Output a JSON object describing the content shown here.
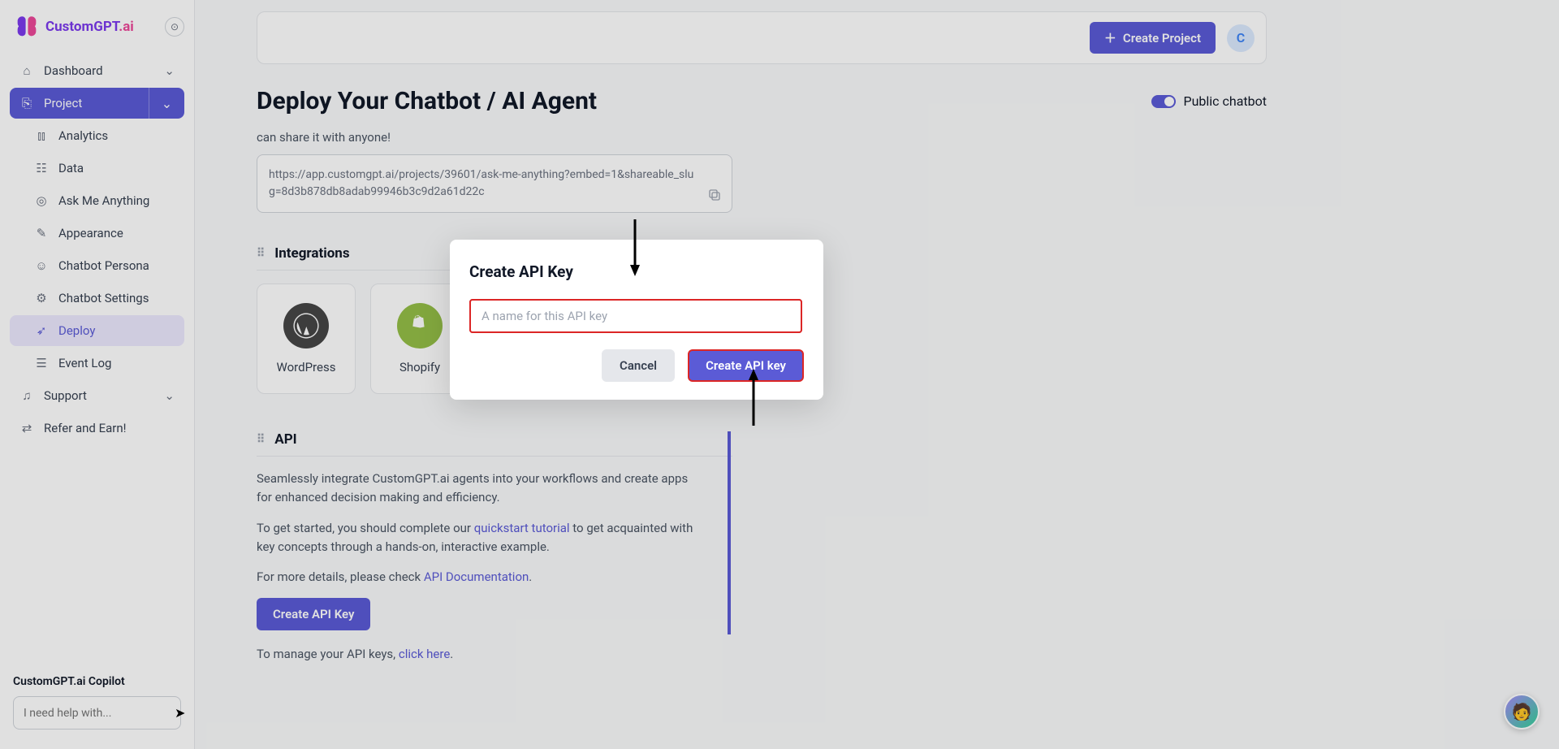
{
  "brand": {
    "name_a": "CustomGPT",
    "name_b": ".ai"
  },
  "sidebar": {
    "items": [
      {
        "label": "Dashboard"
      },
      {
        "label": "Project"
      },
      {
        "label": "Analytics"
      },
      {
        "label": "Data"
      },
      {
        "label": "Ask Me Anything"
      },
      {
        "label": "Appearance"
      },
      {
        "label": "Chatbot Persona"
      },
      {
        "label": "Chatbot Settings"
      },
      {
        "label": "Deploy"
      },
      {
        "label": "Event Log"
      },
      {
        "label": "Support"
      },
      {
        "label": "Refer and Earn!"
      }
    ],
    "copilot_label": "CustomGPT.ai Copilot",
    "copilot_placeholder": "I need help with..."
  },
  "topbar": {
    "create_project": "Create Project",
    "avatar_initial": "C"
  },
  "page": {
    "title": "Deploy Your Chatbot / AI Agent",
    "public_toggle_label": "Public chatbot",
    "share_line": "can share it with anyone!",
    "url": "https://app.customgpt.ai/projects/39601/ask-me-anything?embed=1&shareable_slug=8d3b878db8adab99946b3c9d2a61d22c"
  },
  "integrations": {
    "heading": "Integrations",
    "cards": [
      {
        "label": "WordPress"
      },
      {
        "label": "Shopify"
      }
    ]
  },
  "api": {
    "heading": "API",
    "p1a": "Seamlessly integrate CustomGPT.ai agents into your workflows and create apps for enhanced decision making and efficiency.",
    "p2a": "To get started, you should complete our ",
    "p2link": "quickstart tutorial",
    "p2b": " to get acquainted with key concepts through a hands-on, interactive example.",
    "p3a": "For more details, please check ",
    "p3link": "API Documentation",
    "p3b": ".",
    "create_btn": "Create API Key",
    "manage_a": "To manage your API keys, ",
    "manage_link": "click here",
    "manage_b": "."
  },
  "modal": {
    "title": "Create API Key",
    "placeholder": "A name for this API key",
    "cancel": "Cancel",
    "create": "Create API key"
  }
}
